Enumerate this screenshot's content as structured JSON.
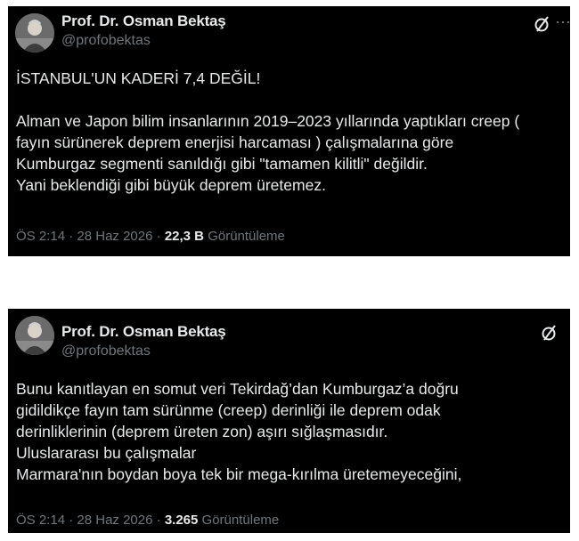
{
  "tweets": [
    {
      "author_name": "Prof. Dr. Osman Bektaş",
      "handle": "@profobektas",
      "lines": [
        "İSTANBUL'UN KADERİ 7,4 DEĞİL!",
        "",
        "Alman ve Japon bilim insanlarının 2019–2023 yıllarında yaptıkları creep (",
        "fayın sürünerek deprem enerjisi harcaması ) çalışmalarına göre",
        "Kumburgaz segmenti sanıldığı gibi \"tamamen kilitli\" değildir.",
        "Yani beklendiği gibi büyük deprem üretemez."
      ],
      "time": "ÖS 2:14",
      "date": "28 Haz 2026",
      "views_count": "22,3 B",
      "views_label": "Görüntüleme"
    },
    {
      "author_name": "Prof. Dr. Osman Bektaş",
      "handle": "@profobektas",
      "lines": [
        "Bunu kanıtlayan en somut veri Tekirdağ’dan Kumburgaz’a doğru",
        "gidildikçe fayın tam sürünme (creep) derinliği ile deprem odak",
        "derinliklerinin (deprem üreten zon) aşırı sığlaşmasıdır.",
        "Uluslararası bu çalışmalar",
        "Marmara'nın boydan boya tek bir mega-kırılma üretemeyeceğini,"
      ],
      "time": "ÖS 2:14",
      "date": "28 Haz 2026",
      "views_count": "3.265",
      "views_label": "Görüntüleme"
    }
  ],
  "separator": "·",
  "icons": {
    "avatar": "avatar-photo",
    "grok": "grok-icon",
    "more": "more-icon"
  },
  "colors": {
    "card_bg": "#000000",
    "text": "#e7e9ea",
    "muted": "#71767b"
  }
}
